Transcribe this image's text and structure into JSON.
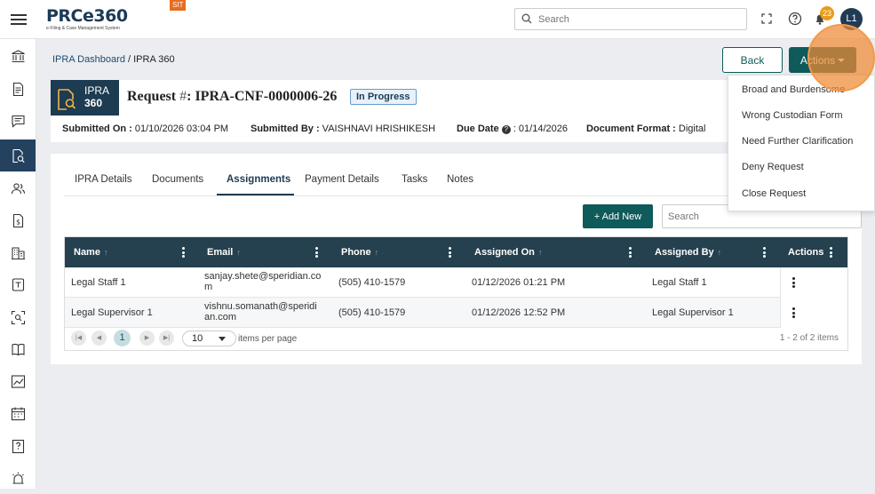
{
  "header": {
    "logo_text": "PRCe360",
    "logo_subtitle": "e-Filing & Case Management System",
    "env_badge": "SIT",
    "search_placeholder": "Search",
    "notification_count": "23",
    "avatar_initials": "L1"
  },
  "sidebar": {
    "items": [
      {
        "icon": "bank-icon"
      },
      {
        "icon": "document-icon"
      },
      {
        "icon": "chat-icon"
      },
      {
        "icon": "document-search-icon",
        "active": true
      },
      {
        "icon": "users-icon"
      },
      {
        "icon": "dollar-document-icon"
      },
      {
        "icon": "building-icon"
      },
      {
        "icon": "tablet-icon"
      },
      {
        "icon": "scan-search-icon"
      },
      {
        "icon": "book-icon"
      },
      {
        "icon": "chart-icon"
      },
      {
        "icon": "calendar-icon"
      },
      {
        "icon": "help-document-icon"
      },
      {
        "icon": "alarm-icon"
      }
    ]
  },
  "breadcrumb": {
    "parent": "IPRA Dashboard",
    "separator": " / ",
    "current": "IPRA 360"
  },
  "buttons": {
    "back": "Back",
    "actions": "Actions"
  },
  "request": {
    "badge_line1": "IPRA",
    "badge_line2": "360",
    "title_prefix": "Request ",
    "title_hash": "#",
    "title_id": ": IPRA-CNF-0000006-26",
    "status": "In Progress",
    "submitted_on_label": "Submitted On : ",
    "submitted_on": "01/10/2026 03:04 PM",
    "submitted_by_label": "Submitted By : ",
    "submitted_by": "VAISHNAVI HRISHIKESH",
    "due_date_label": "Due Date ",
    "due_date": ": 01/14/2026",
    "format_label": "Document Format : ",
    "format": "Digital"
  },
  "tabs": [
    "IPRA Details",
    "Documents",
    "Assignments",
    "Payment Details",
    "Tasks",
    "Notes"
  ],
  "active_tab": "Assignments",
  "toolbar": {
    "add_new": "+ Add New",
    "search_placeholder": "Search"
  },
  "table": {
    "columns": [
      "Name",
      "Email",
      "Phone",
      "Assigned On",
      "Assigned By",
      "Actions"
    ],
    "rows": [
      {
        "name": "Legal Staff 1",
        "email_l1": "sanjay.shete@speridian.co",
        "email_l2": "m",
        "phone": "(505) 410-1579",
        "assigned_on": "01/12/2026 01:21 PM",
        "assigned_by": "Legal Staff 1"
      },
      {
        "name": "Legal Supervisor 1",
        "email_l1": "vishnu.somanath@speridi",
        "email_l2": "an.com",
        "phone": "(505) 410-1579",
        "assigned_on": "01/12/2026 12:52 PM",
        "assigned_by": "Legal Supervisor 1"
      }
    ]
  },
  "pager": {
    "page": "1",
    "page_size": "10",
    "per_page_label": "items per page",
    "info": "1 - 2 of 2 items"
  },
  "actions_menu": {
    "items": [
      "Broad and Burdensome",
      "Wrong Custodian Form",
      "Need Further Clarification",
      "Deny Request",
      "Close Request"
    ]
  }
}
